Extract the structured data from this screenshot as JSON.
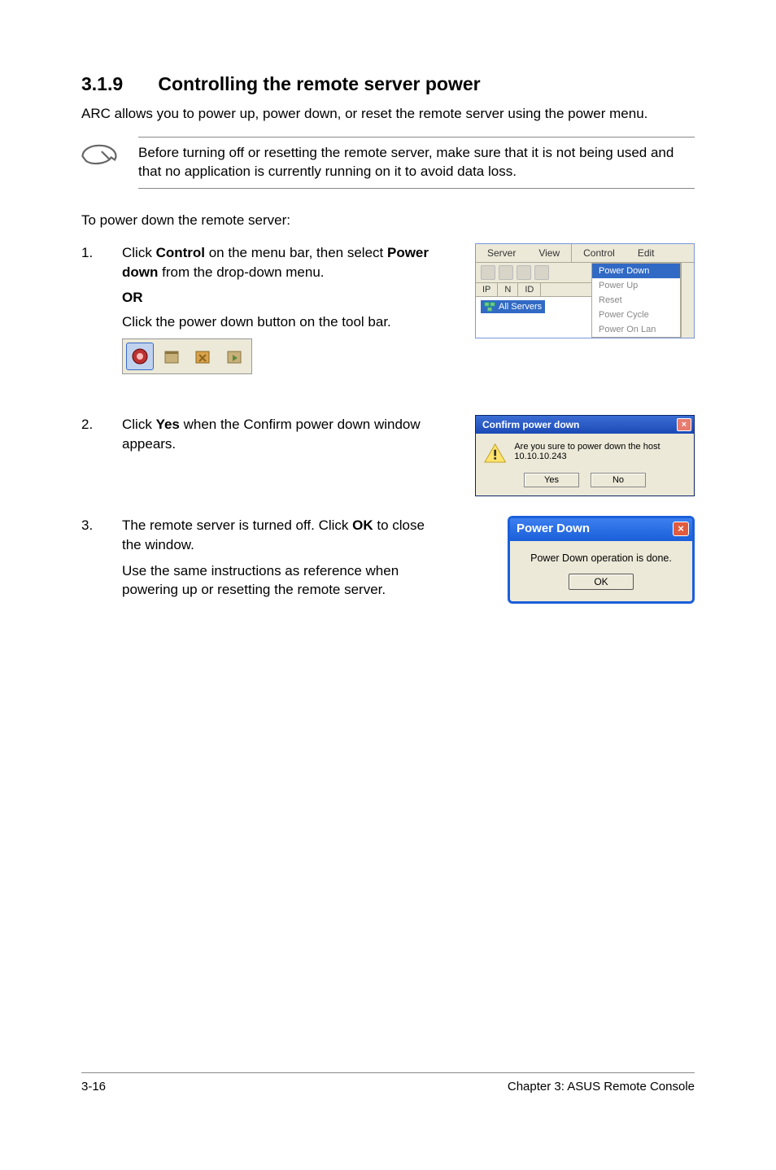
{
  "section": {
    "number": "3.1.9",
    "title": "Controlling the remote server power"
  },
  "intro": "ARC allows you to power up, power down, or reset the remote server using the power menu.",
  "note": "Before turning off or resetting the remote server, make sure that it is not being used and that no application is currently running on it to avoid data loss.",
  "lead": "To power down the remote server:",
  "step1": {
    "num": "1.",
    "line1a": "Click ",
    "line1b": "Control",
    "line1c": " on the menu bar, then select ",
    "line1d": "Power down",
    "line1e": " from the drop-down menu.",
    "or": "OR",
    "line2": "Click the power down button on the tool bar."
  },
  "step2": {
    "num": "2.",
    "a": "Click ",
    "b": "Yes",
    "c": " when the Confirm power down window appears."
  },
  "step3": {
    "num": "3.",
    "line1a": "The remote server is turned off. Click ",
    "line1b": "OK",
    "line1c": " to close the window.",
    "line2": "Use the same instructions as reference when powering up or resetting the remote server."
  },
  "menu_shot": {
    "menubar": [
      "Server",
      "View",
      "Control",
      "Edit"
    ],
    "colheads": [
      "IP",
      "N",
      "ID"
    ],
    "tree_item": "All Servers",
    "dropdown": [
      "Power Down",
      "Power Up",
      "Reset",
      "Power Cycle",
      "Power On Lan"
    ]
  },
  "confirm_dlg": {
    "title": "Confirm power down",
    "msg": "Are you sure to power down the host 10.10.10.243",
    "yes": "Yes",
    "no": "No"
  },
  "done_dlg": {
    "title": "Power Down",
    "msg": "Power Down operation is done.",
    "ok": "OK"
  },
  "footer": {
    "left": "3-16",
    "right": "Chapter 3: ASUS Remote Console"
  }
}
